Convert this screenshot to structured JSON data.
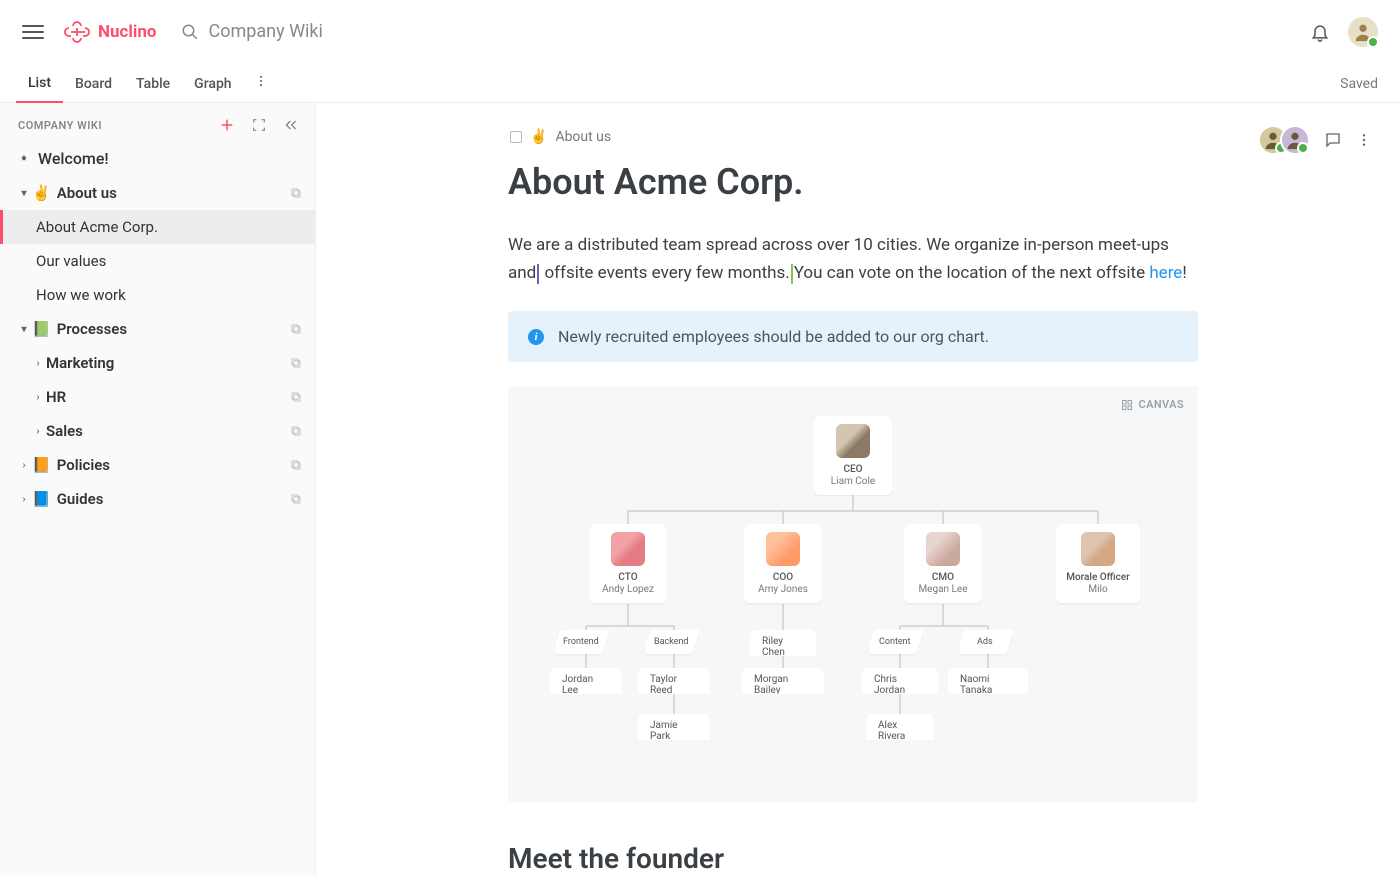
{
  "header": {
    "brand": "Nuclino",
    "search_placeholder": "Company Wiki"
  },
  "tabs": {
    "list": "List",
    "board": "Board",
    "table": "Table",
    "graph": "Graph",
    "saved": "Saved"
  },
  "sidebar": {
    "workspace": "COMPANY WIKI",
    "welcome": "Welcome!",
    "about_us": "About us",
    "about_emoji": "✌️",
    "children": {
      "about_acme": "About Acme Corp.",
      "our_values": "Our values",
      "how_we_work": "How we work"
    },
    "processes": "Processes",
    "processes_emoji": "📗",
    "marketing": "Marketing",
    "hr": "HR",
    "sales": "Sales",
    "policies": "Policies",
    "policies_emoji": "📙",
    "guides": "Guides",
    "guides_emoji": "📘"
  },
  "page": {
    "breadcrumb_emoji": "✌️",
    "breadcrumb": "About us",
    "title": "About Acme Corp.",
    "intro_1": "We are a distributed team spread across over 10 cities. We organize in-person meet-ups and",
    "intro_2": " offsite events every few months.",
    "intro_3": "You can vote on the location of the next offsite ",
    "intro_link": "here",
    "intro_4": "!",
    "info": "Newly recruited employees should be added to our org chart.",
    "canvas_label": "CANVAS",
    "h2": "Meet the founder",
    "org": {
      "ceo_title": "CEO",
      "ceo_name": "Liam Cole",
      "cto_title": "CTO",
      "cto_name": "Andy Lopez",
      "coo_title": "COO",
      "coo_name": "Amy Jones",
      "cmo_title": "CMO",
      "cmo_name": "Megan Lee",
      "morale_title": "Morale Officer",
      "morale_name": "Milo",
      "dept_frontend": "Frontend",
      "dept_backend": "Backend",
      "dept_content": "Content",
      "dept_ads": "Ads",
      "p_jordan": "Jordan Lee",
      "p_taylor": "Taylor Reed",
      "p_jamie": "Jamie Park",
      "p_riley": "Riley Chen",
      "p_morgan": "Morgan Bailey",
      "p_chris": "Chris Jordan",
      "p_alex": "Alex Rivera",
      "p_naomi": "Naomi Tanaka"
    }
  }
}
